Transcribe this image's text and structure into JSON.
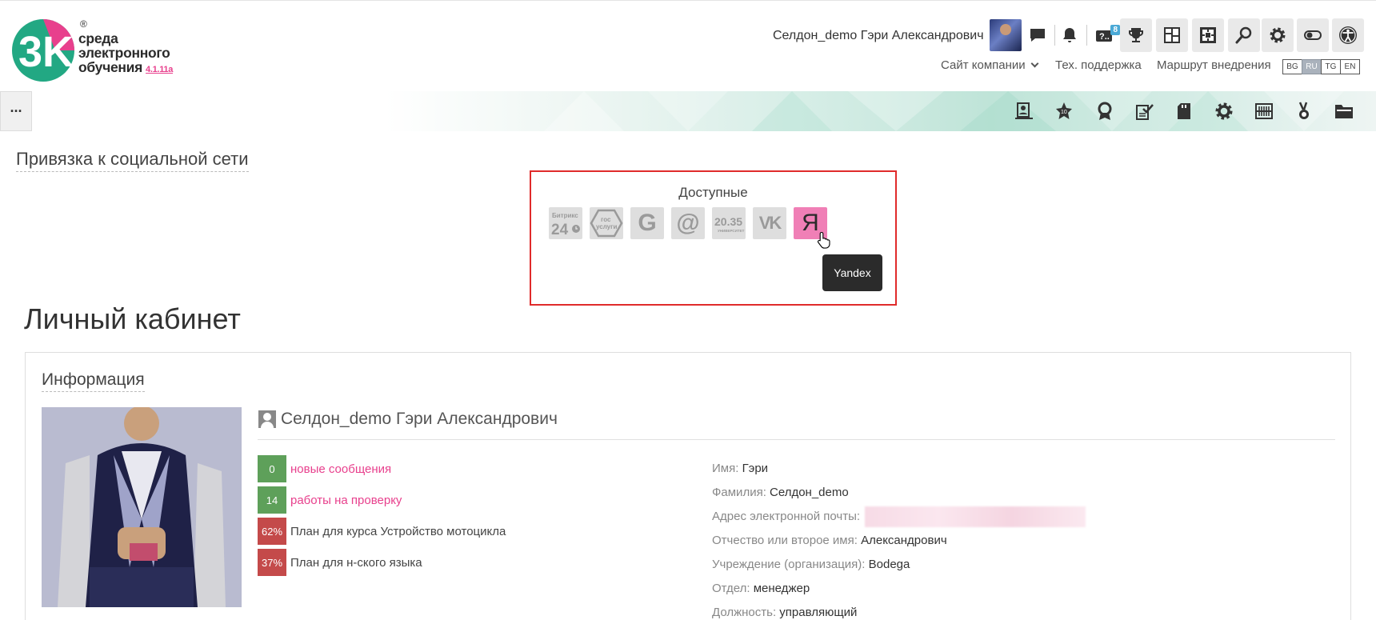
{
  "header": {
    "logo": {
      "mark": "3K",
      "registered": "®",
      "line1": "среда",
      "line2": "электронного",
      "line3": "обучения",
      "version": "4.1.11a"
    },
    "user_name": "Селдон_demo Гэри Александрович",
    "notifications_badge": "8",
    "links": {
      "company_site": "Сайт компании",
      "support": "Тех. поддержка",
      "route": "Маршрут внедрения"
    },
    "languages": [
      "BG",
      "RU",
      "TG",
      "EN"
    ],
    "active_language": "RU"
  },
  "navbar": {
    "menu_label": "···"
  },
  "social": {
    "title": "Привязка к социальной сети",
    "subtitle": "Доступные",
    "providers": [
      {
        "name": "bitrix24",
        "label_top": "Битрикс",
        "label_main": "24"
      },
      {
        "name": "gosuslugi",
        "label_top": "гос",
        "label_main": "услуги"
      },
      {
        "name": "google",
        "label_main": "G"
      },
      {
        "name": "mailru",
        "label_main": "@"
      },
      {
        "name": "2035",
        "label_main": "20.35",
        "label_sub": "УНИВЕРСИТЕТ"
      },
      {
        "name": "vk",
        "label_main": "VK"
      },
      {
        "name": "yandex",
        "label_main": "Я"
      }
    ],
    "tooltip": "Yandex"
  },
  "cabinet": {
    "title": "Личный кабинет",
    "info_title": "Информация",
    "profile_name": "Селдон_demo Гэри Александрович",
    "stats": [
      {
        "value": "0",
        "label": "новые сообщения"
      },
      {
        "value": "14",
        "label": "работы на проверку"
      },
      {
        "value": "62%",
        "label": "План для курса Устройство мотоцикла"
      },
      {
        "value": "37%",
        "label": "План для н-ского языка"
      }
    ],
    "fields": [
      {
        "label": "Имя:",
        "value": "Гэри"
      },
      {
        "label": "Фамилия:",
        "value": "Селдон_demo"
      },
      {
        "label": "Адрес электронной почты:",
        "value": ""
      },
      {
        "label": "Отчество или второе имя:",
        "value": "Александрович"
      },
      {
        "label": "Учреждение (организация):",
        "value": "Bodega"
      },
      {
        "label": "Отдел:",
        "value": "менеджер"
      },
      {
        "label": "Должность:",
        "value": "управляющий"
      }
    ]
  },
  "colors": {
    "accent_pink": "#e8408d",
    "logo_green": "#22a883",
    "stat_green": "#5ea05a",
    "stat_red": "#c44a4a",
    "highlight_border": "#e02b2b",
    "yandex_active": "#f07fb6"
  }
}
